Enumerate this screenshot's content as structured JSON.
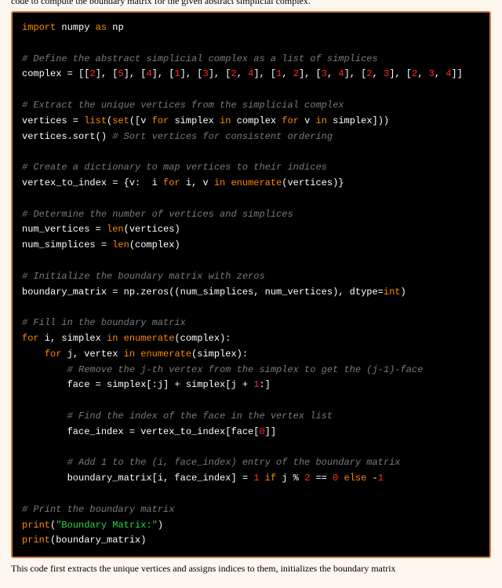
{
  "prose_top": "code to compute the boundary matrix for the given abstract simplicial complex.",
  "prose_bottom": "This code first extracts the unique vertices and assigns indices to them, initializes the boundary matrix",
  "code": {
    "l01a": "import",
    "l01b": " numpy ",
    "l01c": "as",
    "l01d": " np",
    "l03": "# Define the abstract simplicial complex as a list of simplices",
    "l04a": "complex = [[",
    "l04n1": "2",
    "l04b": "], [",
    "l04n2": "5",
    "l04c": "], [",
    "l04n3": "4",
    "l04d": "], [",
    "l04n4": "1",
    "l04e": "], [",
    "l04n5": "3",
    "l04f": "], [",
    "l04n6": "2",
    "l04g": ", ",
    "l04n7": "4",
    "l04h": "], [",
    "l04n8": "1",
    "l04i": ", ",
    "l04n9": "2",
    "l04j": "], [",
    "l04n10": "3",
    "l04k": ", ",
    "l04n11": "4",
    "l04l": "], [",
    "l04n12": "2",
    "l04m": ", ",
    "l04n13": "3",
    "l04n": "], [",
    "l04n14": "2",
    "l04o": ", ",
    "l04n15": "3",
    "l04p": ", ",
    "l04n16": "4",
    "l04q": "]]",
    "l06": "# Extract the unique vertices from the simplicial complex",
    "l07a": "vertices = ",
    "l07b": "list",
    "l07c": "(",
    "l07d": "set",
    "l07e": "([v ",
    "l07f": "for",
    "l07g": " simplex ",
    "l07h": "in",
    "l07i": " complex ",
    "l07j": "for",
    "l07k": " v ",
    "l07l": "in",
    "l07m": " simplex]))",
    "l08a": "vertices.sort() ",
    "l08b": "# Sort vertices for consistent ordering",
    "l10": "# Create a dictionary to map vertices to their indices",
    "l11a": "vertex_to_index = {v:  i ",
    "l11b": "for",
    "l11c": " i, v ",
    "l11d": "in",
    "l11e": " ",
    "l11f": "enumerate",
    "l11g": "(vertices)}",
    "l13": "# Determine the number of vertices and simplices",
    "l14a": "num_vertices = ",
    "l14b": "len",
    "l14c": "(vertices)",
    "l15a": "num_simplices = ",
    "l15b": "len",
    "l15c": "(complex)",
    "l17": "# Initialize the boundary matrix with zeros",
    "l18a": "boundary_matrix = np.zeros((num_simplices, num_vertices), dtype=",
    "l18b": "int",
    "l18c": ")",
    "l20": "# Fill in the boundary matrix",
    "l21a": "for",
    "l21b": " i, simplex ",
    "l21c": "in",
    "l21d": " ",
    "l21e": "enumerate",
    "l21f": "(complex):",
    "l22a": "    ",
    "l22b": "for",
    "l22c": " j, vertex ",
    "l22d": "in",
    "l22e": " ",
    "l22f": "enumerate",
    "l22g": "(simplex):",
    "l23a": "        ",
    "l23b": "# Remove the j-th vertex from the simplex to get the (j-1)-face",
    "l24a": "        face = simplex[:j] + simplex[j + ",
    "l24b": "1",
    "l24c": ":]",
    "l26a": "        ",
    "l26b": "# Find the index of the face in the vertex list",
    "l27a": "        face_index = vertex_to_index[face[",
    "l27b": "0",
    "l27c": "]]",
    "l29a": "        ",
    "l29b": "# Add 1 to the (i, face_index) entry of the boundary matrix",
    "l30a": "        boundary_matrix[i, face_index] = ",
    "l30b": "1",
    "l30c": " ",
    "l30d": "if",
    "l30e": " j % ",
    "l30f": "2",
    "l30g": " == ",
    "l30h": "0",
    "l30i": " ",
    "l30j": "else",
    "l30k": " -",
    "l30l": "1",
    "l32": "# Print the boundary matrix",
    "l33a": "print",
    "l33b": "(",
    "l33c": "\"Boundary Matrix:\"",
    "l33d": ")",
    "l34a": "print",
    "l34b": "(boundary_matrix)"
  }
}
